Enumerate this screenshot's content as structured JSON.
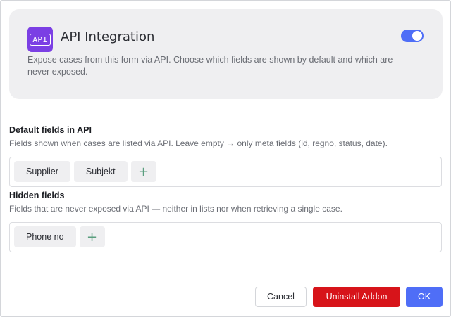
{
  "addon": {
    "icon": "api-icon",
    "icon_text": "API",
    "title": "API Integration",
    "enabled": true,
    "description": "Expose cases from this form via API. Choose which fields are shown by default and which are never exposed."
  },
  "default_fields": {
    "title": "Default fields in API",
    "help": "Fields shown when cases are listed via API. Leave empty → only meta fields (id, regno, status, date).",
    "chips": [
      "Supplier",
      "Subjekt"
    ],
    "add_icon": "plus-icon"
  },
  "hidden_fields": {
    "title": "Hidden fields",
    "help": "Fields that are never exposed via API — neither in lists nor when retrieving a single case.",
    "chips": [
      "Phone no"
    ],
    "add_icon": "plus-icon"
  },
  "buttons": {
    "cancel": "Cancel",
    "uninstall": "Uninstall Addon",
    "ok": "OK"
  },
  "colors": {
    "accent": "#4f6ef7",
    "danger": "#d7141a",
    "icon_bg": "#7b3fe4",
    "add_icon": "#5a9e7e"
  }
}
